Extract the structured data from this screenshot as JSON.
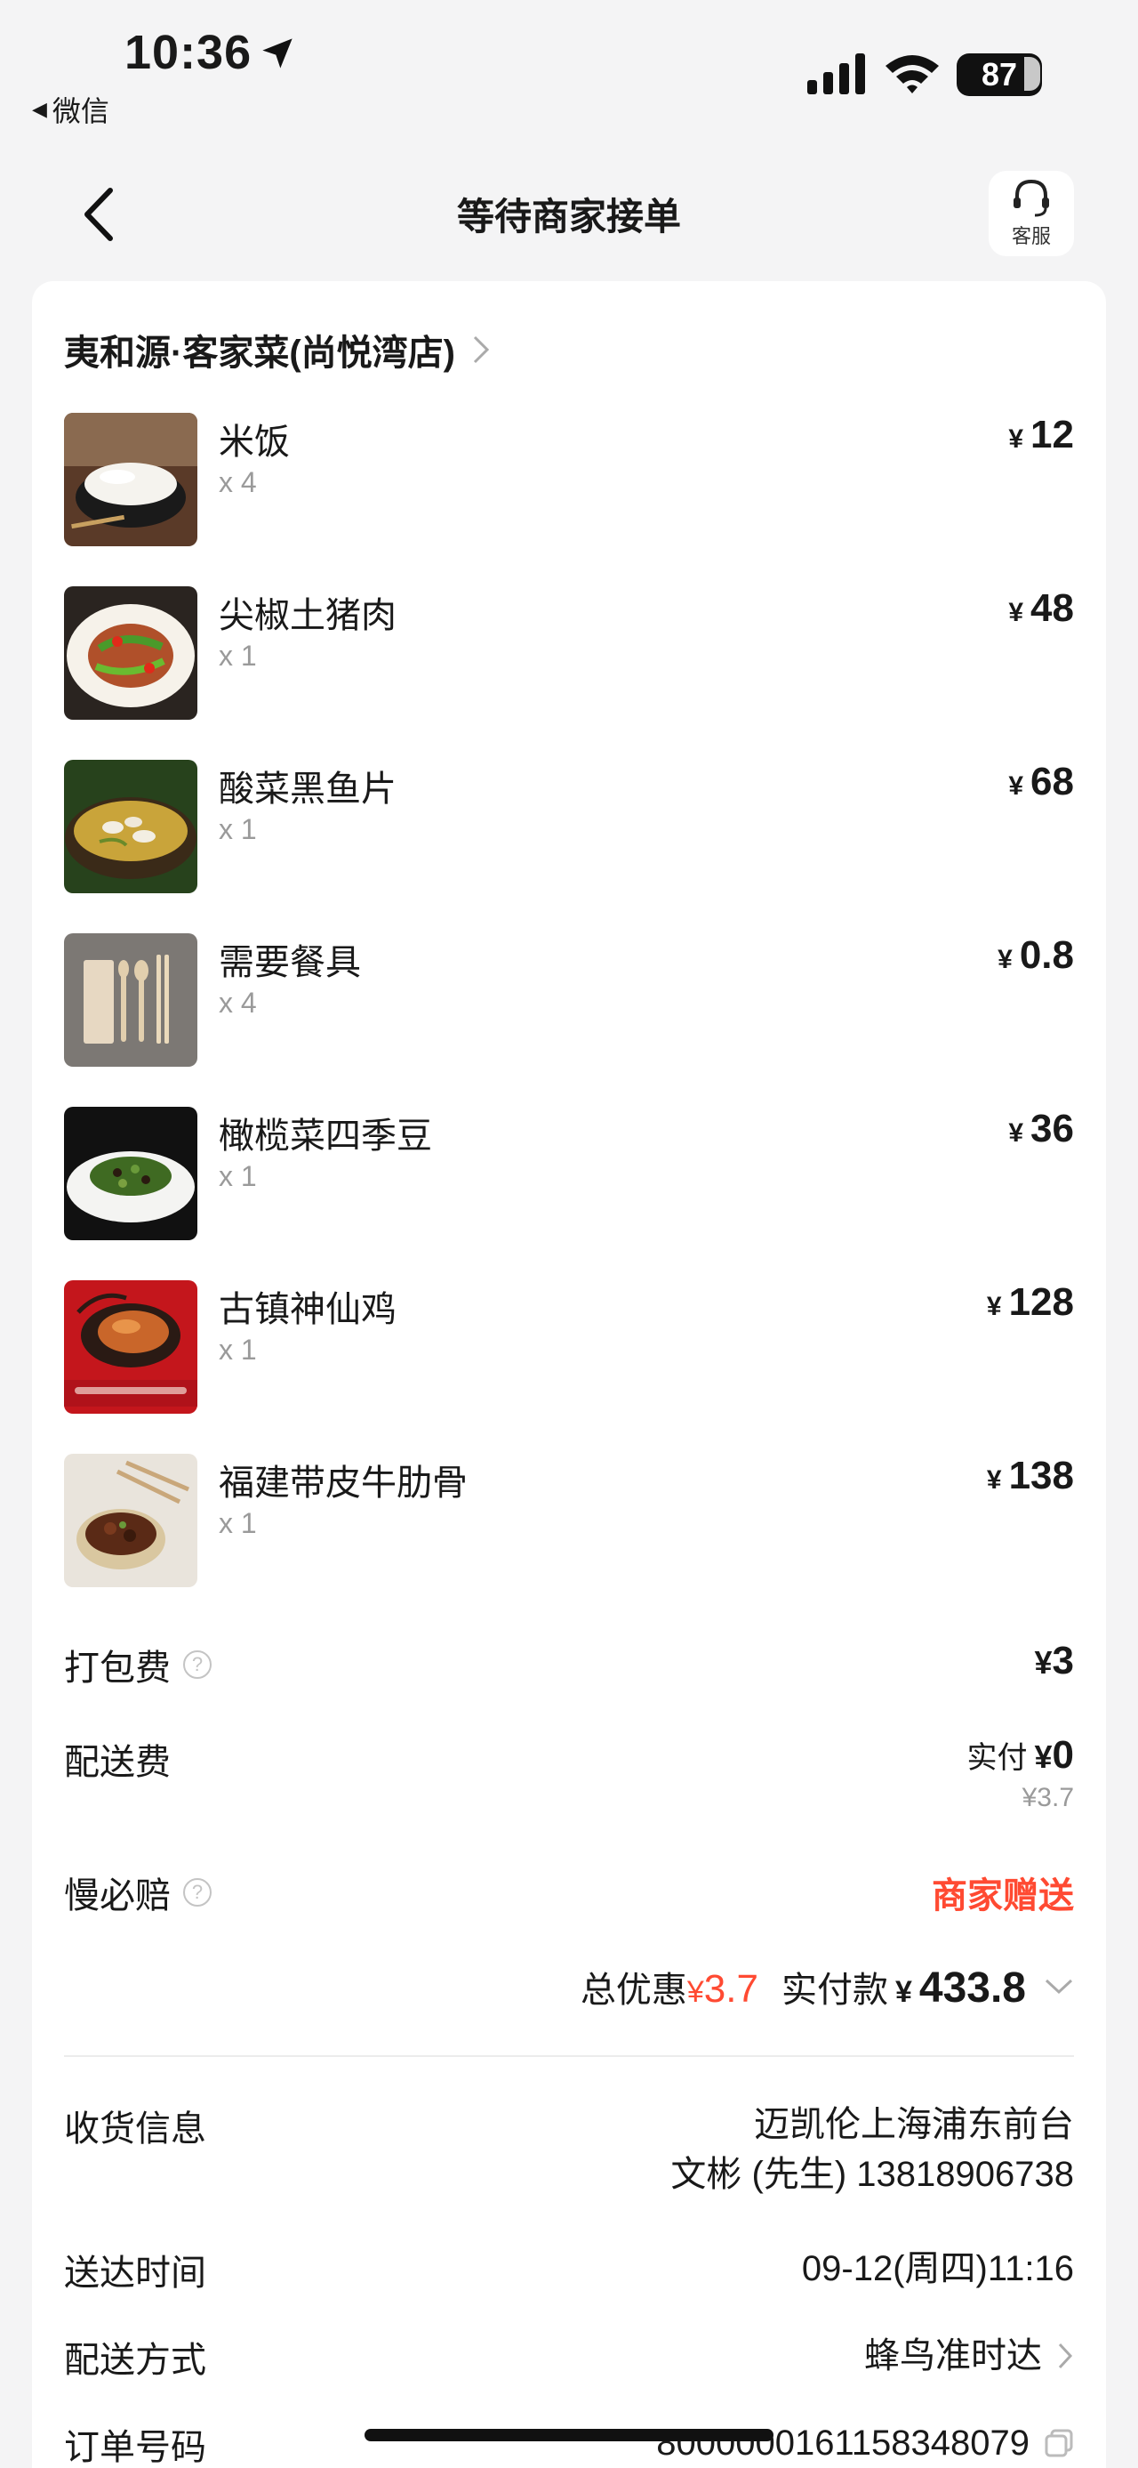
{
  "status_bar": {
    "time": "10:36",
    "back_app": "微信",
    "battery": "87"
  },
  "nav": {
    "title": "等待商家接单",
    "service_label": "客服"
  },
  "order": {
    "shop_name": "夷和源·客家菜(尚悦湾店)",
    "currency": "¥",
    "items": [
      {
        "name": "米饭",
        "qty": "x 4",
        "price": "12",
        "thumb": "rice-bowl"
      },
      {
        "name": "尖椒土猪肉",
        "qty": "x 1",
        "price": "48",
        "thumb": "pepper-pork-plate"
      },
      {
        "name": "酸菜黑鱼片",
        "qty": "x 1",
        "price": "68",
        "thumb": "fish-soup-bowl"
      },
      {
        "name": "需要餐具",
        "qty": "x 4",
        "price": "0.8",
        "thumb": "cutlery-set"
      },
      {
        "name": "橄榄菜四季豆",
        "qty": "x 1",
        "price": "36",
        "thumb": "green-beans-plate"
      },
      {
        "name": "古镇神仙鸡",
        "qty": "x 1",
        "price": "128",
        "thumb": "chicken-clay-pot"
      },
      {
        "name": "福建带皮牛肋骨",
        "qty": "x 1",
        "price": "138",
        "thumb": "beef-rib-pot"
      }
    ],
    "packing_fee": {
      "label": "打包费",
      "amount": "3"
    },
    "delivery_fee": {
      "label": "配送费",
      "actual_label": "实付",
      "amount": "0",
      "original": "¥3.7"
    },
    "slow_compensation": {
      "label": "慢必赔",
      "value": "商家赠送"
    },
    "totals": {
      "discount_label": "总优惠",
      "discount": "3.7",
      "paid_label": "实付款",
      "paid": "433.8"
    }
  },
  "delivery": {
    "receiver_label": "收货信息",
    "address": "迈凯伦上海浦东前台",
    "contact": "文彬 (先生) 13818906738",
    "time_label": "送达时间",
    "time": "09-12(周四)11:16",
    "method_label": "配送方式",
    "method": "蜂鸟准时达",
    "order_no_label": "订单号码",
    "order_no": "8000000161158348079"
  },
  "colors": {
    "accent_red": "#ff4a32",
    "background": "#f4f4f5"
  }
}
